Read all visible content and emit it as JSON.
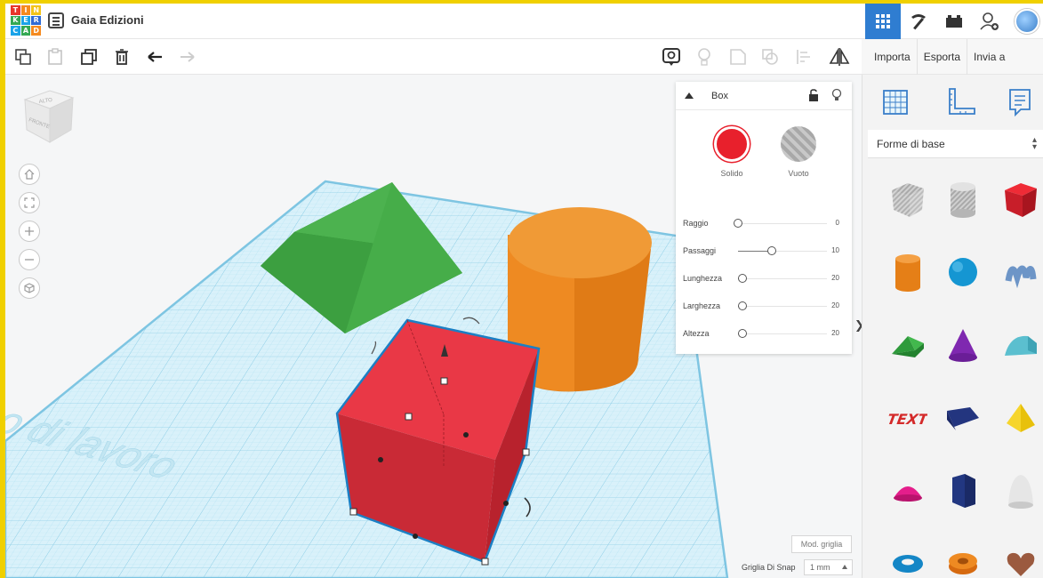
{
  "app": {
    "project_title": "Gaia Edizioni",
    "logo_letters": [
      "T",
      "I",
      "N",
      "K",
      "E",
      "R",
      "C",
      "A",
      "D"
    ],
    "logo_colors": [
      "#e8352b",
      "#f58a1f",
      "#f3c318",
      "#34a853",
      "#1aa3e8",
      "#2f6bd6",
      "#1aa3e8",
      "#34a853",
      "#f58a1f"
    ]
  },
  "top_actions": [
    {
      "name": "grid-view-icon",
      "active": true
    },
    {
      "name": "pickaxe-icon",
      "active": false
    },
    {
      "name": "bricks-icon",
      "active": false
    },
    {
      "name": "add-user-icon",
      "active": false
    },
    {
      "name": "avatar",
      "active": false
    }
  ],
  "toolbar": {
    "actions": [
      "copy-icon",
      "paste-icon",
      "duplicate-icon",
      "delete-icon",
      "undo-icon",
      "redo-icon"
    ],
    "view_actions": [
      "notes-icon",
      "bulb-icon",
      "group-icon",
      "ungroup-icon",
      "align-icon",
      "mirror-icon"
    ]
  },
  "right_toolbar": {
    "import_label": "Importa",
    "export_label": "Esporta",
    "send_label": "Invia a"
  },
  "viewcube": {
    "top_label": "ALTO",
    "front_label": "FRONTE"
  },
  "workplane": {
    "label": "Piano di lavoro",
    "colors": {
      "grid": "#a7dcef",
      "plane": "#d7f0f9",
      "box": "#e02a36",
      "cylinder": "#ee8a22",
      "roof": "#3ea040"
    }
  },
  "inspector": {
    "shape_name": "Box",
    "solid_label": "Solido",
    "hole_label": "Vuoto",
    "solid_color": "#e8202c",
    "params": [
      {
        "label": "Raggio",
        "value": "0",
        "fraction": 0.0
      },
      {
        "label": "Passaggi",
        "value": "10",
        "fraction": 0.38
      },
      {
        "label": "Lunghezza",
        "value": "20",
        "fraction": 0.05
      },
      {
        "label": "Larghezza",
        "value": "20",
        "fraction": 0.05
      },
      {
        "label": "Altezza",
        "value": "20",
        "fraction": 0.05
      }
    ]
  },
  "snap": {
    "edit_grid_label": "Mod. griglia",
    "snap_label": "Griglia Di Snap",
    "snap_value": "1 mm"
  },
  "shapes_panel": {
    "category": "Forme di base",
    "tools": [
      "workplane-icon",
      "ruler-icon",
      "notes-icon"
    ],
    "shapes": [
      {
        "name": "box-hole-shape"
      },
      {
        "name": "cylinder-hole-shape"
      },
      {
        "name": "box-shape"
      },
      {
        "name": "cylinder-shape"
      },
      {
        "name": "sphere-shape"
      },
      {
        "name": "scribble-shape"
      },
      {
        "name": "roof-shape"
      },
      {
        "name": "cone-shape"
      },
      {
        "name": "round-roof-shape"
      },
      {
        "name": "text-shape"
      },
      {
        "name": "half-cylinder-shape"
      },
      {
        "name": "pyramid-shape"
      },
      {
        "name": "half-sphere-shape"
      },
      {
        "name": "polygon-shape"
      },
      {
        "name": "paraboloid-shape"
      },
      {
        "name": "torus-shape"
      },
      {
        "name": "tube-shape"
      },
      {
        "name": "heart-shape"
      }
    ]
  }
}
